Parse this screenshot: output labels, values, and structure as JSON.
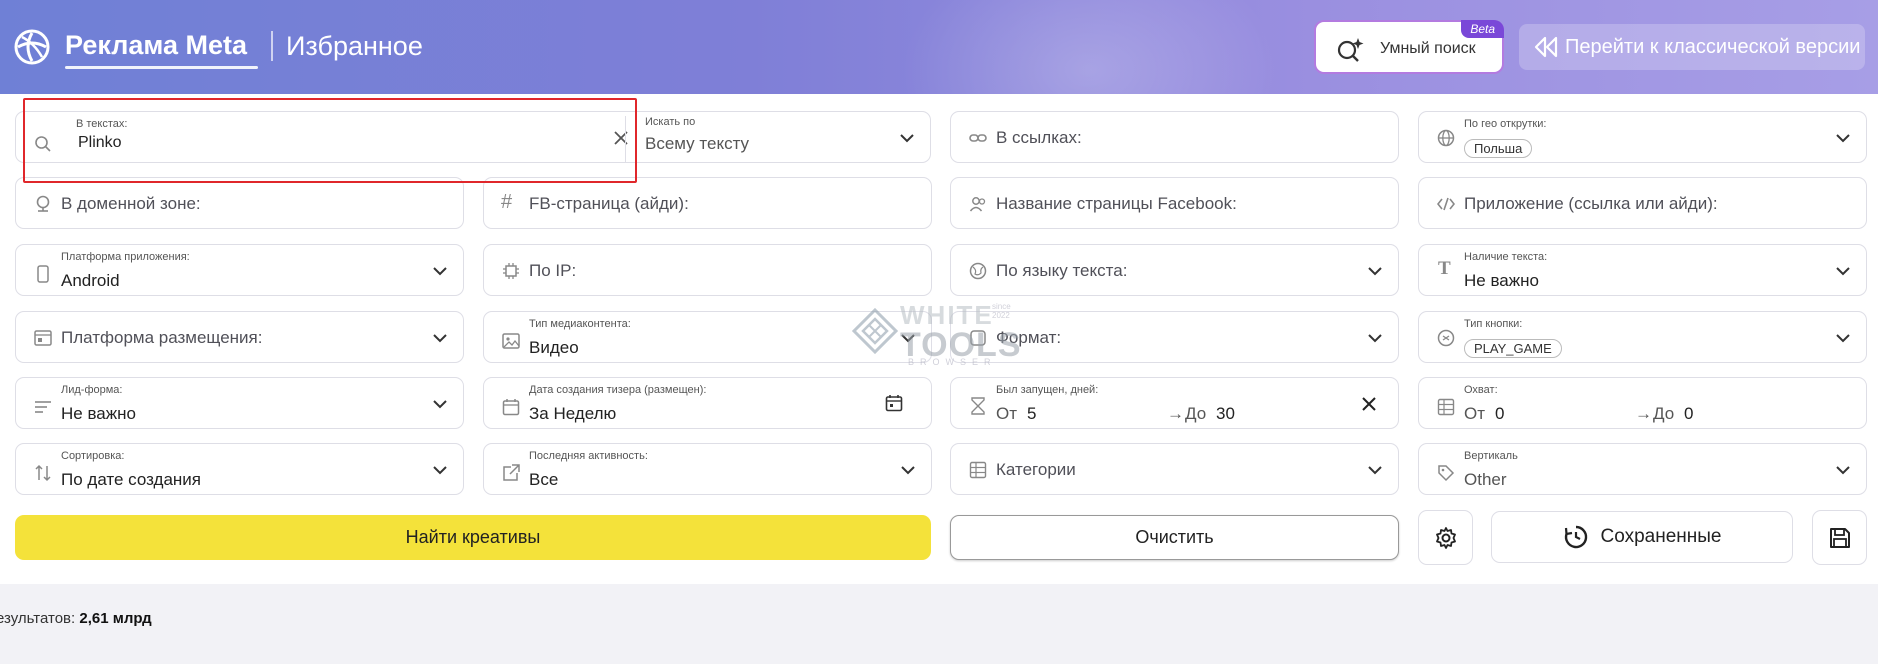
{
  "header": {
    "brand": "Реклама Meta",
    "subtitle": "Избранное",
    "smart_search": {
      "label": "Умный поиск",
      "badge": "Beta"
    },
    "classic_button": "Перейти к классической версии"
  },
  "filters": {
    "texts": {
      "label": "В текстах:",
      "value": "Plinko"
    },
    "search_by": {
      "label": "Искать по",
      "value": "Всему тексту"
    },
    "links": {
      "label": "В ссылках:"
    },
    "geo": {
      "label": "По гео открутки:",
      "chip": "Польша"
    },
    "domain_zone": {
      "label": "В доменной зоне:"
    },
    "fb_page_id": {
      "label": "FB-страница (айди):"
    },
    "fb_page_name": {
      "label": "Название страницы Facebook:"
    },
    "app": {
      "label": "Приложение (ссылка или айди):"
    },
    "app_platform": {
      "label": "Платформа приложения:",
      "value": "Android"
    },
    "ip": {
      "label": "По IP:"
    },
    "text_language": {
      "label": "По языку текста:"
    },
    "text_presence": {
      "label": "Наличие текста:",
      "value": "Не важно"
    },
    "placement": {
      "label": "Платформа размещения:"
    },
    "media_type": {
      "label": "Тип медиаконтента:",
      "value": "Видео"
    },
    "format": {
      "label": "Формат:"
    },
    "button_type": {
      "label": "Тип кнопки:",
      "chip": "PLAY_GAME"
    },
    "lead_form": {
      "label": "Лид-форма:",
      "value": "Не важно"
    },
    "creation_date": {
      "label": "Дата создания тизера (размещен):",
      "value": "За Неделю"
    },
    "days_running": {
      "label": "Был запущен, дней:",
      "from_label": "От",
      "from": "5",
      "to_label": "До",
      "to": "30"
    },
    "reach": {
      "label": "Охват:",
      "from_label": "От",
      "from": "0",
      "to_label": "До",
      "to": "0"
    },
    "sort": {
      "label": "Сортировка:",
      "value": "По дате создания"
    },
    "last_activity": {
      "label": "Последняя активность:",
      "value": "Все"
    },
    "categories": {
      "label": "Категории"
    },
    "vertical": {
      "label": "Вертикаль",
      "value": "Other"
    }
  },
  "actions": {
    "find": "Найти креативы",
    "clear": "Очистить",
    "saved": "Сохраненные"
  },
  "results": {
    "label": "езультатов:",
    "count": "2,61 млрд"
  },
  "watermark": {
    "line1": "WHITE",
    "line2": "TOOLS",
    "line3": "BROWSER",
    "since": "since",
    "year": "2022"
  },
  "colors": {
    "accent_yellow": "#f4e23a",
    "header_purple": "#7f7fd7",
    "highlight_red": "#e0272b",
    "beta_purple": "#7a48d8"
  }
}
